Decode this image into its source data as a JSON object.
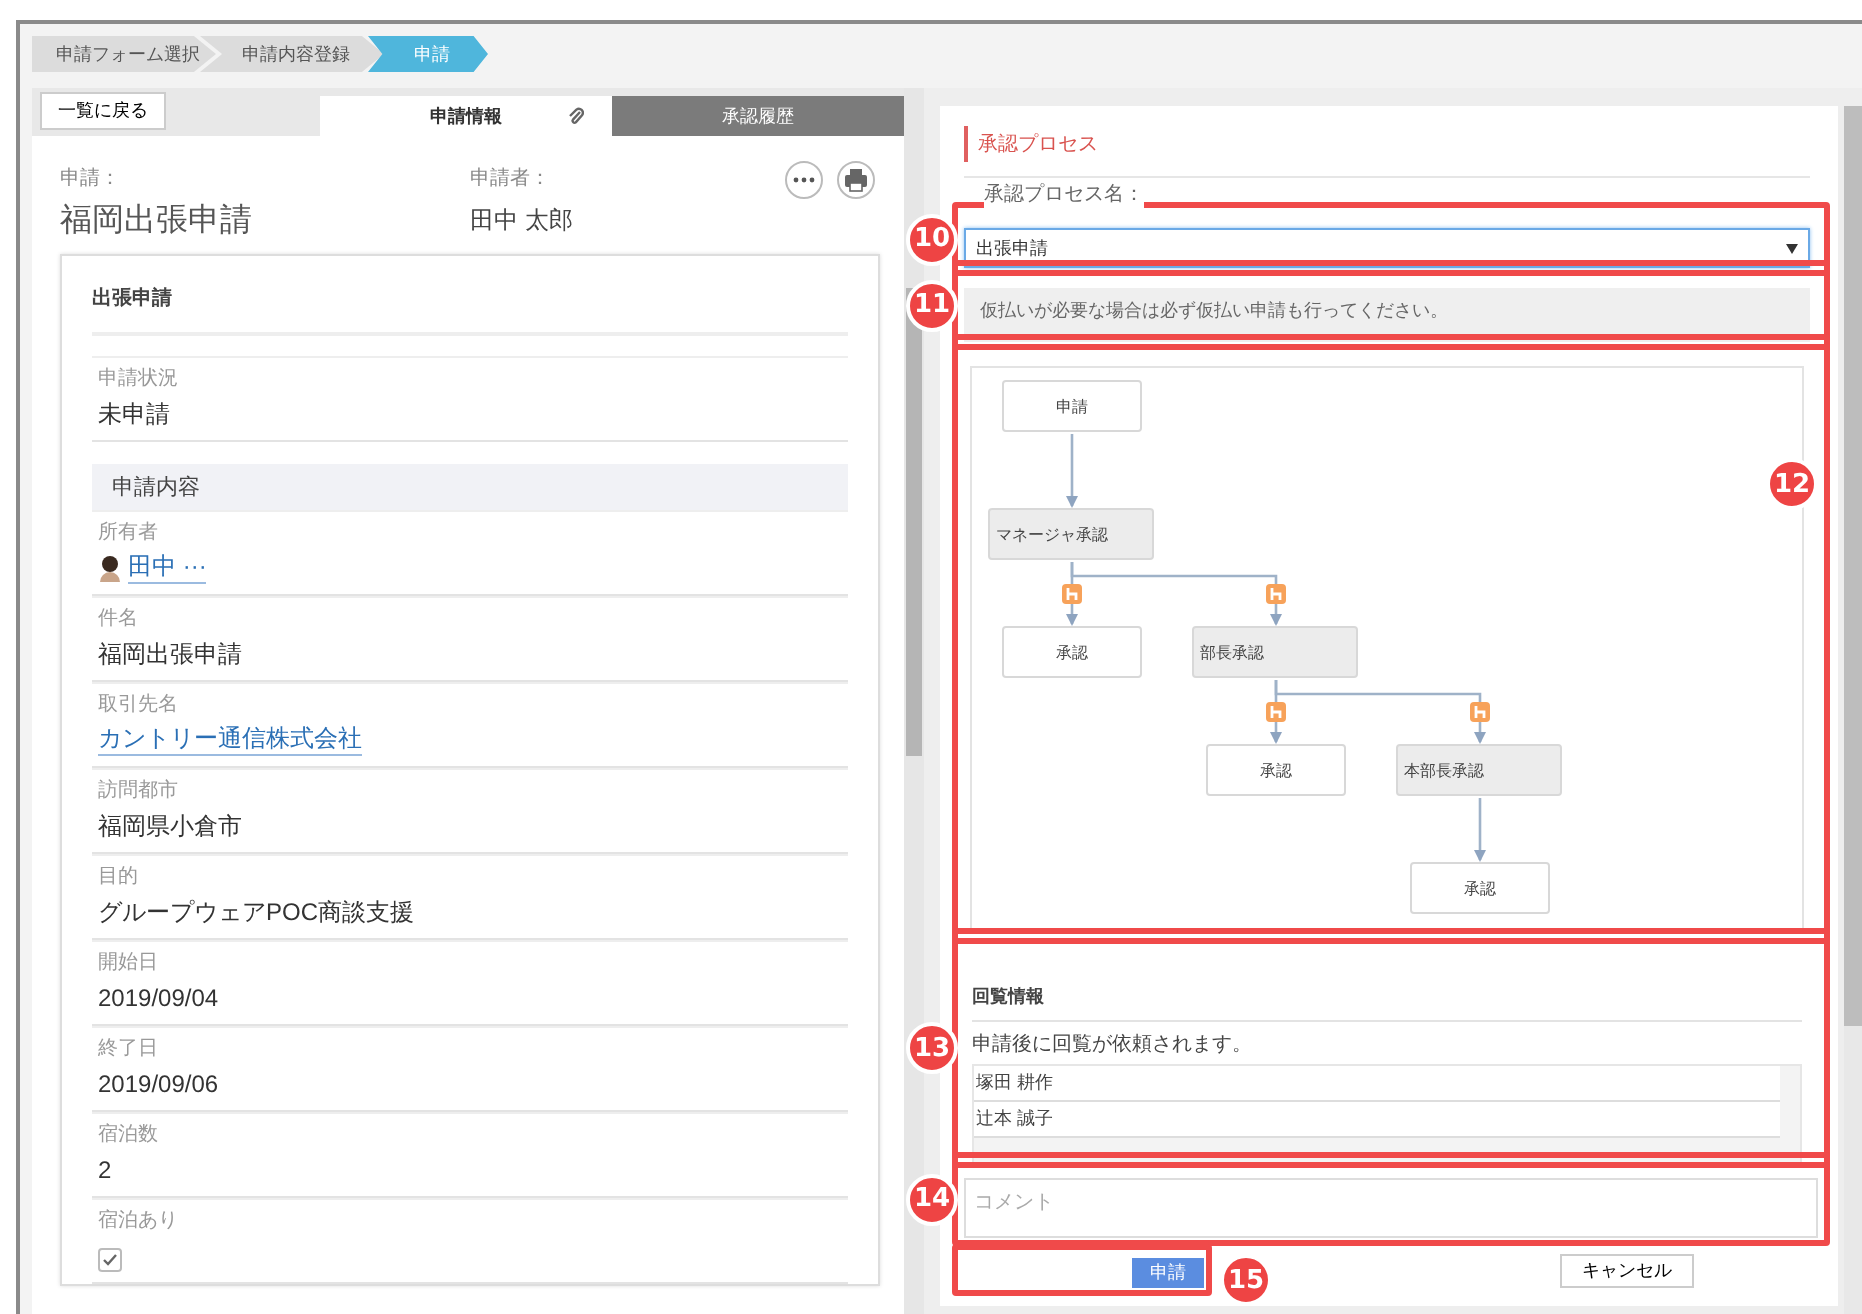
{
  "breadcrumb": [
    {
      "label": "申請フォーム選択",
      "selected": false
    },
    {
      "label": "申請内容登録",
      "selected": false
    },
    {
      "label": "申請",
      "selected": true
    }
  ],
  "left_panel": {
    "back_button": "一覧に戻る",
    "tabs": [
      {
        "label": "申請情報",
        "selected": true
      },
      {
        "label": "承認履歴",
        "selected": false
      }
    ],
    "application_label": "申請：",
    "application_title": "福岡出張申請",
    "applicant_label": "申請者：",
    "applicant_name": "田中 太郎",
    "form_title": "出張申請",
    "status_field": {
      "label": "申請状況",
      "value": "未申請"
    },
    "section_title": "申請内容",
    "fields": [
      {
        "kind": "user",
        "label": "所有者",
        "value": "田中 ···"
      },
      {
        "kind": "text",
        "label": "件名",
        "value": "福岡出張申請"
      },
      {
        "kind": "link",
        "label": "取引先名",
        "value": "カントリー通信株式会社"
      },
      {
        "kind": "text",
        "label": "訪問都市",
        "value": "福岡県小倉市"
      },
      {
        "kind": "text",
        "label": "目的",
        "value": "グループウェアPOC商談支援"
      },
      {
        "kind": "text",
        "label": "開始日",
        "value": "2019/09/04"
      },
      {
        "kind": "text",
        "label": "終了日",
        "value": "2019/09/06"
      },
      {
        "kind": "text",
        "label": "宿泊数",
        "value": "2"
      },
      {
        "kind": "checkbox",
        "label": "宿泊あり",
        "checked": true
      }
    ]
  },
  "right_panel": {
    "section_title": "承認プロセス",
    "process_label": "承認プロセス名：",
    "process_select": {
      "value": "出張申請",
      "callout": "10"
    },
    "note": {
      "text": "仮払いが必要な場合は必ず仮払い申請も行ってください。",
      "callout": "11"
    },
    "flow": {
      "callout": "12",
      "root": {
        "label": "申請",
        "kind": "step",
        "children": [
          {
            "label": "マネージャ承認",
            "kind": "approval",
            "children": [
              {
                "label": "承認",
                "kind": "step"
              },
              {
                "label": "部長承認",
                "kind": "approval",
                "children": [
                  {
                    "label": "承認",
                    "kind": "step"
                  },
                  {
                    "label": "本部長承認",
                    "kind": "approval",
                    "children": [
                      {
                        "label": "承認",
                        "kind": "step"
                      }
                    ]
                  }
                ]
              }
            ]
          }
        ]
      }
    },
    "circulation": {
      "callout": "13",
      "title": "回覧情報",
      "description": "申請後に回覧が依頼されます。",
      "members": [
        "塚田 耕作",
        "辻本 誠子"
      ]
    },
    "comment": {
      "placeholder": "コメント",
      "callout": "14"
    },
    "submit_button": {
      "label": "申請",
      "callout": "15"
    },
    "cancel_button": "キャンセル"
  }
}
